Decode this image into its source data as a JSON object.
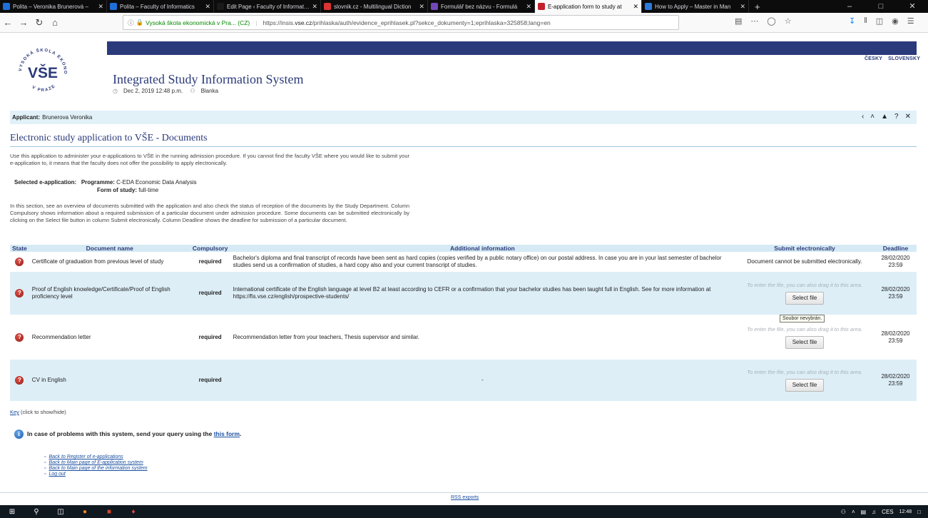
{
  "browser": {
    "tabs": [
      {
        "label": "Polita – Veronika Brunerová – ",
        "favicon_color": "#1e6fd9",
        "active": false
      },
      {
        "label": "Polita – Faculty of Informatics",
        "favicon_color": "#1e6fd9",
        "active": false
      },
      {
        "label": "Edit Page ‹ Faculty of Informatics",
        "favicon_color": "#1a1a1a",
        "active": false
      },
      {
        "label": "slovnik.cz - Multilingual Diction",
        "favicon_color": "#d33",
        "active": false
      },
      {
        "label": "Formulář bez názvu - Formulá",
        "favicon_color": "#7248b9",
        "active": false
      },
      {
        "label": "E-application form to study at",
        "favicon_color": "#c2212b",
        "active": true
      },
      {
        "label": "How to Apply – Master in Man",
        "favicon_color": "#2d7bd9",
        "active": false
      }
    ],
    "new_tab": "+",
    "url_org": "Vysoká škola ekonomická v Pra... (CZ)",
    "url_prefix": "https://insis.",
    "url_domain": "vse.cz",
    "url_path": "/prihlaska/auth/evidence_eprihlasek.pl?sekce_dokumenty=1;eprihlaska=325858;lang=en"
  },
  "header": {
    "lang_cesky": "ČESKY",
    "lang_slovensky": "SLOVENSKY",
    "system_title": "Integrated Study Information System",
    "datetime": "Dec 2, 2019  12:48 p.m.",
    "user": "Blanka",
    "logo_text": "VŠE",
    "logo_ring_top": "VYSOKÁ ŠKOLA EKONOMICKÁ",
    "logo_ring_bottom": "V PRAZE"
  },
  "applicant": {
    "label": "Applicant:",
    "name": "Brunerova Veronika"
  },
  "page": {
    "title": "Electronic study application to VŠE - Documents",
    "intro": "Use this application to administer your e-applications to VŠE in the running admission procedure. If you cannot find the faculty VŠE where you would like to submit your e-application to, it means that the faculty does not offer the possibility to apply electronically.",
    "selected_label": "Selected e-application:",
    "programme_label": "Programme:",
    "programme_value": "C-EDA Economic Data Analysis",
    "form_label": "Form of study:",
    "form_value": "full-time",
    "overview": "In this section, see an overview of documents submitted with the application and also check the status of reception of the documents by the Study Department. Column Compulsory shows information about a required submission of a particular document under admission procedure. Some documents can be submitted electronically by clicking on the Select file button in column Submit electronically. Column Deadline shows the deadline for submission of a particular document."
  },
  "table": {
    "headers": {
      "state": "State",
      "name": "Document name",
      "compulsory": "Compulsory",
      "info": "Additional information",
      "submit": "Submit electronically",
      "deadline": "Deadline"
    },
    "drop_text": "To enter the file, you can also drag it to this area.",
    "select_label": "Select file",
    "tooltip": "Soubor nevybrán.",
    "rows": [
      {
        "name": "Certificate of graduation from previous level of study",
        "compulsory": "required",
        "info": "Bachelor's diploma and final transcript of records have been sent as hard copies (copies verified by a public notary office) on our postal address. In case you are in your last semester of bachelor studies send us a confirmation of studies, a hard copy also and your current transcript of studies.",
        "submit_text": "Document cannot be submitted electronically.",
        "deadline_date": "28/02/2020",
        "deadline_time": "23:59"
      },
      {
        "name": "Proof of English knowledge/Certificate/Proof of English proficiency level",
        "compulsory": "required",
        "info": "International certificate of the English language at level B2 at least according to CEFR or a confirmation that your bachelor studies has been taught full in English. See for more information at https://fis.vse.cz/english/prospective-students/",
        "deadline_date": "28/02/2020",
        "deadline_time": "23:59"
      },
      {
        "name": "Recommendation letter",
        "compulsory": "required",
        "info": "Recommendation letter from your teachers, Thesis supervisor and similar.",
        "deadline_date": "28/02/2020",
        "deadline_time": "23:59"
      },
      {
        "name": "CV in English",
        "compulsory": "required",
        "info": "-",
        "deadline_date": "28/02/2020",
        "deadline_time": "23:59"
      }
    ]
  },
  "footer": {
    "key_link": "Key",
    "key_hint": "(click to show/hide)",
    "help_text": "In case of problems with this system, send your query using the",
    "help_link": "this form",
    "help_end": ".",
    "links": [
      "Back to Register of e-applications",
      "Back to Main page of E-application system",
      "Back to Main page of the information system",
      "Log out"
    ],
    "rss": "RSS exports"
  },
  "taskbar": {
    "lang": "CES",
    "time": "12:48"
  }
}
